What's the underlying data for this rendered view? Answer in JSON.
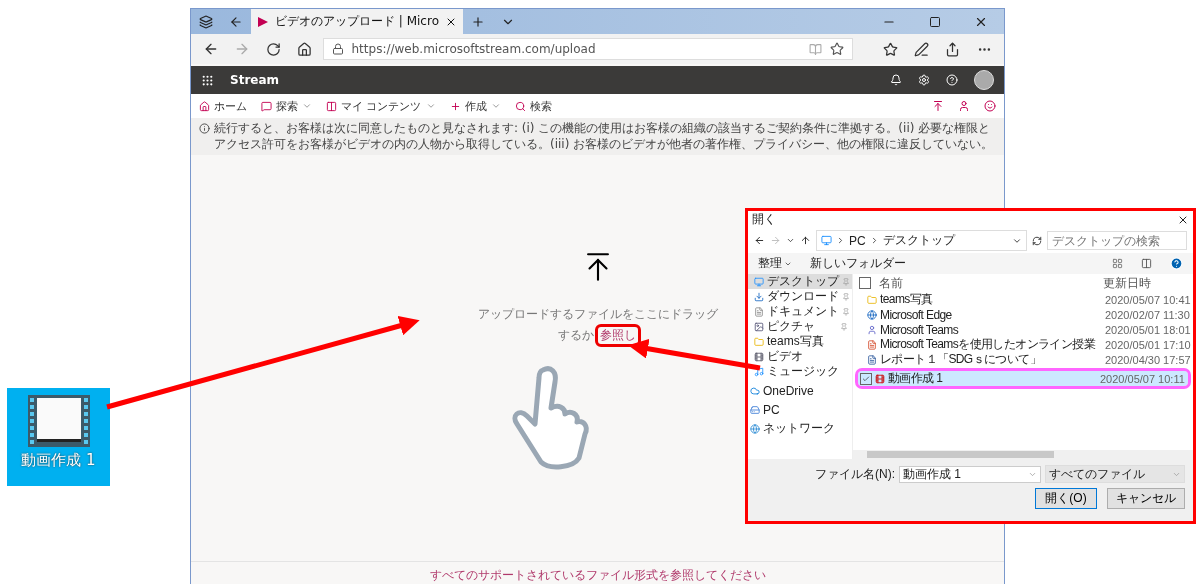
{
  "browser": {
    "tabs": [
      {
        "title": "ビデオのアップロード | Micro",
        "selected": true
      }
    ],
    "url": "https://web.microsoftstream.com/upload"
  },
  "app_bar": {
    "name": "Stream"
  },
  "nav": [
    {
      "label": "ホーム",
      "dropdown": false,
      "kind": "home"
    },
    {
      "label": "探索",
      "dropdown": true,
      "kind": "explore"
    },
    {
      "label": "マイ コンテンツ",
      "dropdown": true,
      "kind": "content"
    },
    {
      "label": "作成",
      "dropdown": true,
      "kind": "create"
    }
  ],
  "search_label": "検索",
  "notice": "続行すると、お客様は次に同意したものと見なされます: (i) この機能の使用はお客様の組織の該当するご契約条件に準拠する。(ii) 必要な権限とアクセス許可をお客様がビデオの内の人物から取得している。(iii) お客様のビデオが他者の著作権、プライバシー、他の権限に違反していない。",
  "upload": {
    "line1": "アップロードするファイルをここにドラッグ",
    "line2": "するか",
    "browse_link": "参照し"
  },
  "footer_link": "すべてのサポートされているファイル形式を参照してください",
  "desktop_file": {
    "label": "動画作成 1"
  },
  "dialog": {
    "title": "開く",
    "path": [
      "PC",
      "デスクトップ"
    ],
    "search_placeholder": "デスクトップの検索",
    "toolbar": [
      "整理",
      "新しいフォルダー"
    ],
    "sidebar": [
      {
        "label": "デスクトップ",
        "kind": "desktop",
        "selected": true,
        "pinned": true
      },
      {
        "label": "ダウンロード",
        "kind": "download",
        "selected": false,
        "pinned": true
      },
      {
        "label": "ドキュメント",
        "kind": "document",
        "selected": false,
        "pinned": true
      },
      {
        "label": "ピクチャ",
        "kind": "picture",
        "selected": false,
        "pinned": true
      },
      {
        "label": "teams写真",
        "kind": "folder",
        "selected": false,
        "pinned": false
      },
      {
        "label": "ビデオ",
        "kind": "video",
        "selected": false,
        "pinned": false
      },
      {
        "label": "ミュージック",
        "kind": "music",
        "selected": false,
        "pinned": false
      },
      {
        "label": "OneDrive",
        "kind": "cloud",
        "selected": false,
        "pinned": false
      },
      {
        "label": "PC",
        "kind": "pc",
        "selected": false,
        "pinned": false
      },
      {
        "label": "ネットワーク",
        "kind": "network",
        "selected": false,
        "pinned": false
      }
    ],
    "columns": [
      "名前",
      "更新日時"
    ],
    "header_checked": false,
    "files": [
      {
        "name": "teams写真",
        "date": "2020/05/07 10:41",
        "kind": "folder",
        "selected": false
      },
      {
        "name": "Microsoft Edge",
        "date": "2020/02/07 11:30",
        "kind": "edge",
        "selected": false
      },
      {
        "name": "Microsoft Teams",
        "date": "2020/05/01 18:01",
        "kind": "teams",
        "selected": false
      },
      {
        "name": "Microsoft Teamsを使用したオンライン授業",
        "date": "2020/05/01 17:10",
        "kind": "slides",
        "selected": false
      },
      {
        "name": "レポート１「SDGｓについて」",
        "date": "2020/04/30 17:57",
        "kind": "doc",
        "selected": false
      },
      {
        "name": "動画作成 1",
        "date": "2020/05/07 10:11",
        "kind": "video",
        "selected": true
      }
    ],
    "filename_label": "ファイル名(N):",
    "filename": "動画作成 1",
    "filter": "すべてのファイル",
    "buttons": [
      "開く(O)",
      "キャンセル"
    ]
  }
}
